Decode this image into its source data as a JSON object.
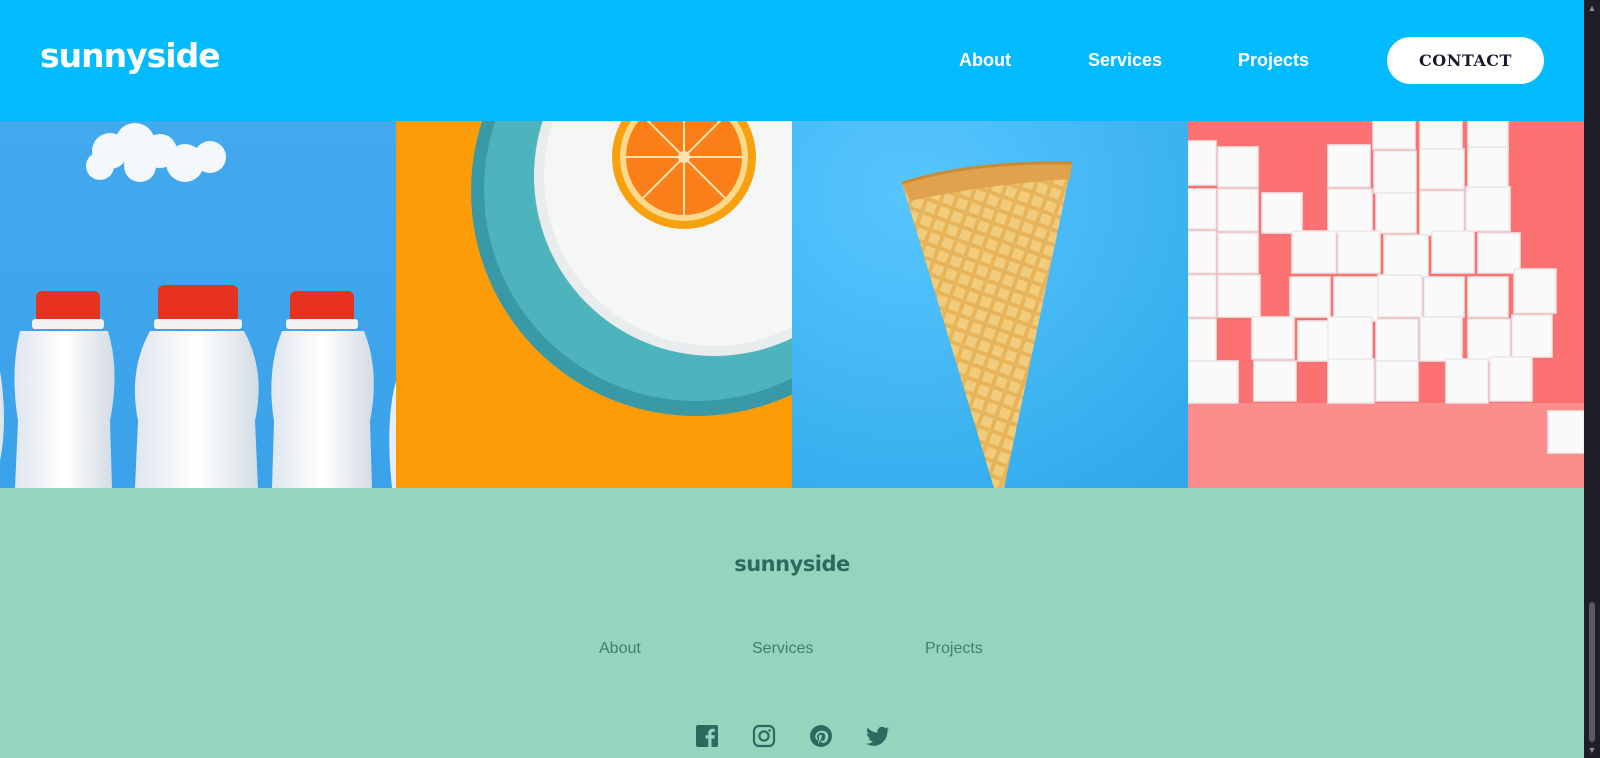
{
  "header": {
    "logo": "sunnyside",
    "nav": [
      "About",
      "Services",
      "Projects"
    ],
    "contact_label": "CONTACT"
  },
  "gallery": {
    "tiles": [
      "milk-bottles-image",
      "orange-plate-image",
      "ice-cream-cone-image",
      "sugar-cubes-image"
    ]
  },
  "footer": {
    "logo": "sunnyside",
    "nav": [
      "About",
      "Services",
      "Projects"
    ],
    "social_icons": [
      "facebook-icon",
      "instagram-icon",
      "pinterest-icon",
      "twitter-icon"
    ]
  },
  "colors": {
    "header_bg": "#02bbff",
    "footer_bg": "#94d6bd",
    "footer_text": "#2c6a5f"
  }
}
